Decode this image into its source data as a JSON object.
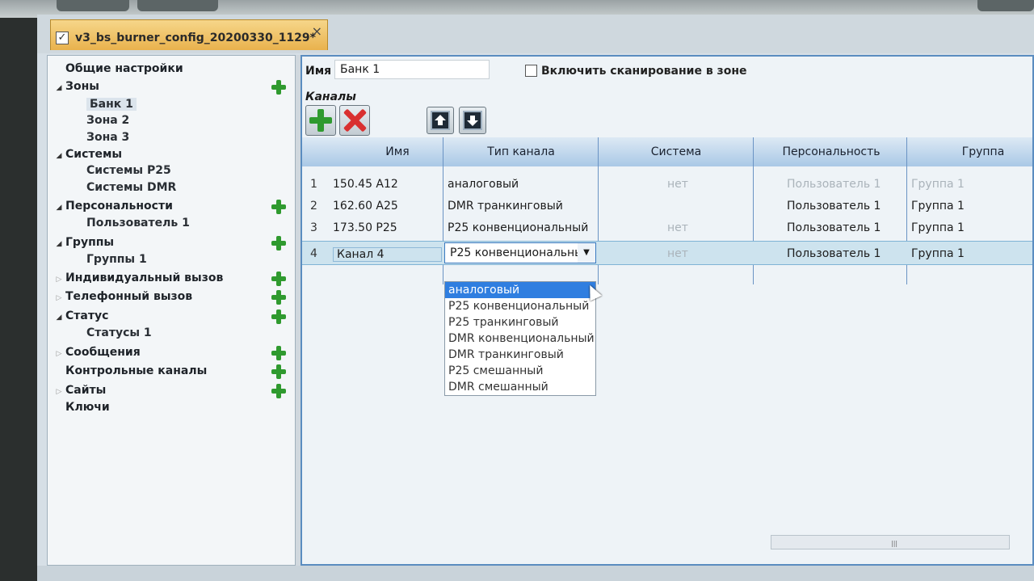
{
  "document_tab": {
    "title": "v3_bs_burner_config_20200330_1129*",
    "close": "×"
  },
  "tree": {
    "items": [
      {
        "label": "Общие настройки",
        "level": 0,
        "expanded": null,
        "add": false
      },
      {
        "label": "Зоны",
        "level": 0,
        "expanded": true,
        "add": true
      },
      {
        "label": "Банк 1",
        "level": 1,
        "selected": true
      },
      {
        "label": "Зона 2",
        "level": 1
      },
      {
        "label": "Зона 3",
        "level": 1
      },
      {
        "label": "Системы",
        "level": 0,
        "expanded": true,
        "add": false
      },
      {
        "label": "Системы P25",
        "level": 1
      },
      {
        "label": "Системы DMR",
        "level": 1
      },
      {
        "label": "Персональности",
        "level": 0,
        "expanded": true,
        "add": true
      },
      {
        "label": "Пользователь 1",
        "level": 1
      },
      {
        "label": "Группы",
        "level": 0,
        "expanded": true,
        "add": true
      },
      {
        "label": "Группы 1",
        "level": 1
      },
      {
        "label": "Индивидуальный вызов",
        "level": 0,
        "expanded": false,
        "add": true
      },
      {
        "label": "Телефонный вызов",
        "level": 0,
        "expanded": false,
        "add": true
      },
      {
        "label": "Статус",
        "level": 0,
        "expanded": true,
        "add": true
      },
      {
        "label": "Статусы 1",
        "level": 1
      },
      {
        "label": "Сообщения",
        "level": 0,
        "expanded": false,
        "add": true
      },
      {
        "label": "Контрольные каналы",
        "level": 0,
        "expanded": null,
        "add": true
      },
      {
        "label": "Сайты",
        "level": 0,
        "expanded": false,
        "add": true
      },
      {
        "label": "Ключи",
        "level": 0,
        "expanded": null,
        "add": false
      }
    ]
  },
  "form": {
    "name_label": "Имя",
    "name_value": "Банк 1",
    "scan_label": "Включить сканирование в зоне",
    "channels_label": "Каналы"
  },
  "grid": {
    "columns": [
      "Имя",
      "Тип канала",
      "Система",
      "Персональность",
      "Группа"
    ],
    "rows": [
      {
        "num": "1",
        "name": "150.45 A12",
        "type": "аналоговый",
        "system": "нет",
        "personality": "Пользователь 1",
        "group": "Группа 1",
        "faded": true
      },
      {
        "num": "2",
        "name": "162.60 A25",
        "type": "DMR транкинговый",
        "system": "",
        "personality": "Пользователь 1",
        "group": "Группа 1"
      },
      {
        "num": "3",
        "name": "173.50 P25",
        "type": "P25 конвенциональный",
        "system": "нет",
        "personality": "Пользователь 1",
        "group": "Группа 1"
      },
      {
        "num": "4",
        "name": "Канал 4",
        "type": "P25 конвенциональнь",
        "system": "нет",
        "personality": "Пользователь 1",
        "group": "Группа 1",
        "selected": true
      }
    ]
  },
  "dropdown": {
    "options": [
      "аналоговый",
      "P25 конвенциональный",
      "P25 транкинговый",
      "DMR конвенциональный",
      "DMR транкинговый",
      "P25 смешанный",
      "DMR смешанный"
    ],
    "highlighted": 0
  },
  "icons": {
    "add": "plus-icon",
    "delete": "delete-icon",
    "up": "move-up-icon",
    "down": "move-down-icon"
  }
}
